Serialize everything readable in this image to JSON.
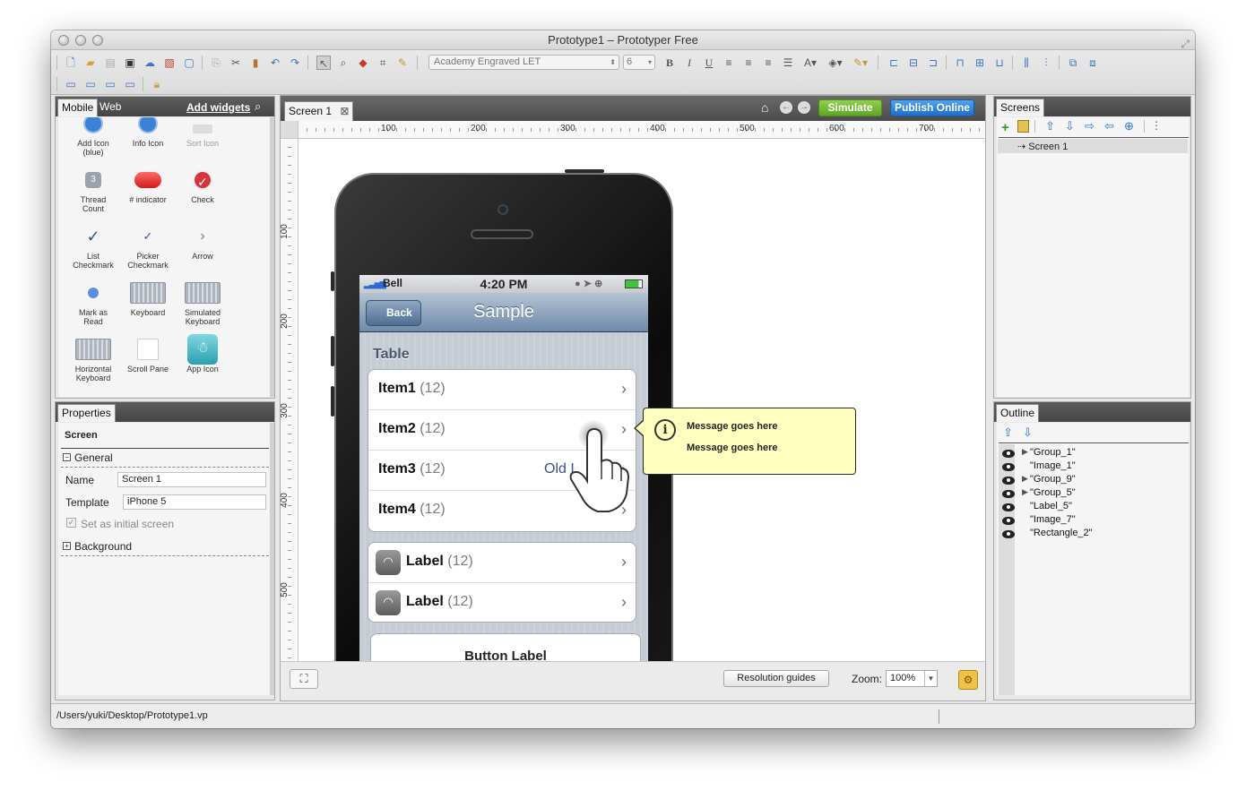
{
  "window": {
    "title": "Prototype1 – Prototyper Free",
    "status_path": "/Users/yuki/Desktop/Prototype1.vp"
  },
  "toolbar": {
    "font_name": "Academy Engraved LET",
    "font_size": "6"
  },
  "widgets_panel": {
    "tabs": [
      "Mobile",
      "Web"
    ],
    "add_widgets": "Add widgets",
    "items": [
      {
        "label": "Add Icon\n(blue)",
        "icon": "add-icon-blue"
      },
      {
        "label": "Info Icon",
        "icon": "info-icon"
      },
      {
        "label": "Sort Icon",
        "icon": "sort-icon"
      },
      {
        "label": "Thread\nCount",
        "icon": "thread-count-icon",
        "badge": "3"
      },
      {
        "label": "# indicator",
        "icon": "indicator-icon"
      },
      {
        "label": "Check",
        "icon": "check-icon"
      },
      {
        "label": "List\nCheckmark",
        "icon": "list-checkmark-icon"
      },
      {
        "label": "Picker\nCheckmark",
        "icon": "picker-checkmark-icon"
      },
      {
        "label": "Arrow",
        "icon": "arrow-icon"
      },
      {
        "label": "Mark as\nRead",
        "icon": "mark-as-read-icon"
      },
      {
        "label": "Keyboard",
        "icon": "keyboard-icon"
      },
      {
        "label": "Simulated\nKeyboard",
        "icon": "simulated-keyboard-icon"
      },
      {
        "label": "Horizontal\nKeyboard",
        "icon": "horizontal-keyboard-icon"
      },
      {
        "label": "Scroll Pane",
        "icon": "scroll-pane-icon"
      },
      {
        "label": "App Icon",
        "icon": "app-icon"
      }
    ]
  },
  "properties": {
    "tab": "Properties",
    "heading": "Screen",
    "general": "General",
    "name_label": "Name",
    "name_value": "Screen 1",
    "template_label": "Template",
    "template_value": "iPhone 5",
    "initial_screen": "Set as initial screen",
    "background": "Background"
  },
  "canvas": {
    "tab": "Screen 1",
    "simulate": "Simulate",
    "publish": "Publish Online",
    "ruler_h": [
      "100",
      "200",
      "300",
      "400",
      "500",
      "600",
      "700"
    ],
    "ruler_v": [
      "100",
      "200",
      "300",
      "400",
      "500"
    ],
    "resolution_guides": "Resolution guides",
    "zoom_label": "Zoom:",
    "zoom_value": "100%"
  },
  "phone": {
    "carrier": "Bell",
    "time": "4:20 PM",
    "back": "Back",
    "nav_title": "Sample",
    "section": "Table",
    "rows": [
      {
        "title": "Item1",
        "count": "(12)"
      },
      {
        "title": "Item2",
        "count": "(12)"
      },
      {
        "title": "Item3",
        "count": "(12)",
        "detail": "Old I"
      },
      {
        "title": "Item4",
        "count": "(12)"
      }
    ],
    "label_rows": [
      {
        "title": "Label",
        "count": "(12)"
      },
      {
        "title": "Label",
        "count": "(12)"
      }
    ],
    "button_label": "Button Label"
  },
  "callout": {
    "line1": "Message goes here",
    "line2": "Message goes here"
  },
  "screens_panel": {
    "tab": "Screens",
    "items": [
      "Screen 1"
    ]
  },
  "outline_panel": {
    "tab": "Outline",
    "items": [
      "\"Group_1\"",
      "\"Image_1\"",
      "\"Group_9\"",
      "\"Group_5\"",
      "\"Label_5\"",
      "\"Image_7\"",
      "\"Rectangle_2\""
    ]
  }
}
